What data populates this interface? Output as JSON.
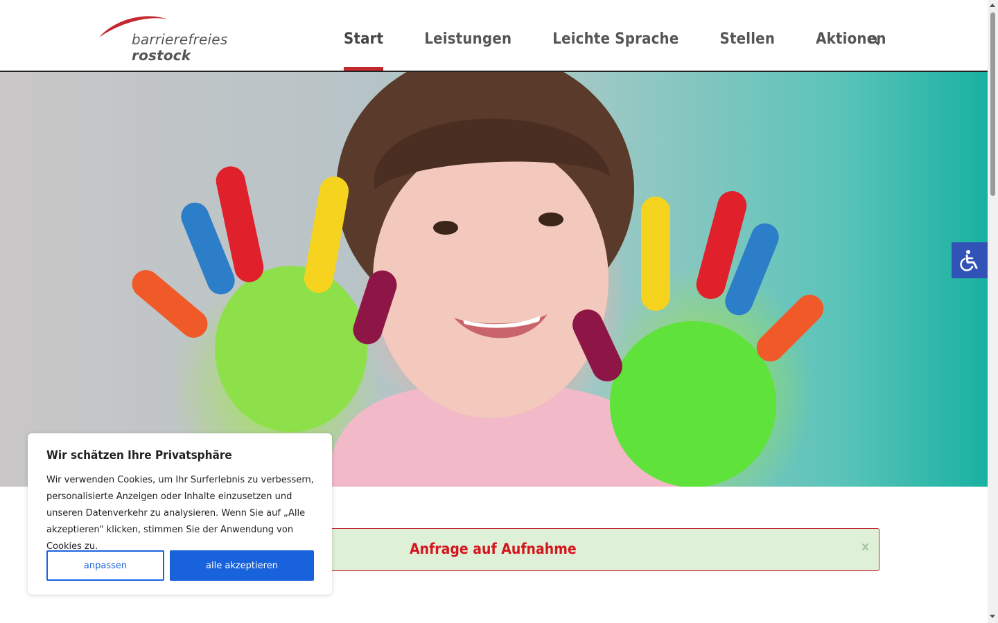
{
  "header": {
    "logo": {
      "line1": "barrierefreies",
      "line2": "rostock",
      "accent_color": "#c3282f"
    },
    "nav": [
      {
        "label": "Start",
        "active": true
      },
      {
        "label": "Leistungen",
        "active": false
      },
      {
        "label": "Leichte Sprache",
        "active": false
      },
      {
        "label": "Stellen",
        "active": false
      },
      {
        "label": "Aktionen",
        "active": false
      }
    ],
    "search_icon": "search-icon"
  },
  "hero": {
    "image": "child-with-painted-hands"
  },
  "accessibility": {
    "icon": "wheelchair-icon",
    "color": "#3153b8"
  },
  "notice": {
    "text": "Anfrage auf Aufnahme",
    "close_label": "x",
    "bg_color": "#dff0d8",
    "text_color": "#d5151c"
  },
  "cookie": {
    "title": "Wir schätzen Ihre Privatsphäre",
    "text": "Wir verwenden Cookies, um Ihr Surferlebnis zu verbessern, personalisierte Anzeigen oder Inhalte einzusetzen und unseren Datenverkehr zu analysieren. Wenn Sie auf „Alle akzeptieren\" klicken, stimmen Sie der Anwendung von Cookies zu.",
    "customize_label": "anpassen",
    "accept_label": "alle akzeptieren",
    "button_color": "#1863dc"
  }
}
